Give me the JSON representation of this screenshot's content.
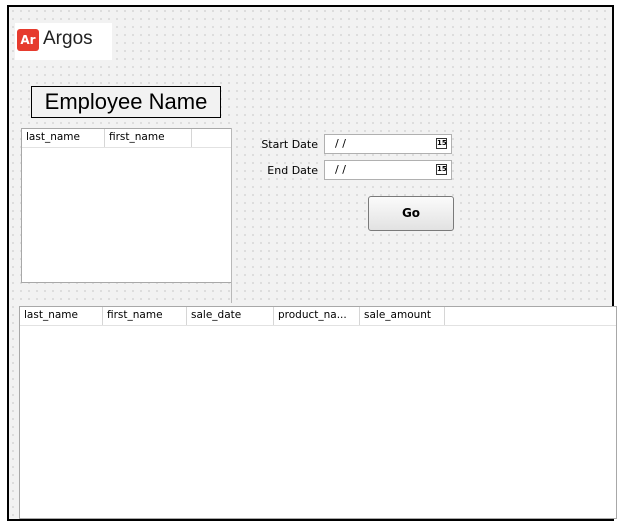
{
  "logo": {
    "badge": "Ar",
    "name": "Argos"
  },
  "employee_label": "Employee Name",
  "employee_grid": {
    "columns": [
      "last_name",
      "first_name"
    ]
  },
  "filters": {
    "start_date_label": "Start Date",
    "start_date_value": "/ /",
    "end_date_label": "End Date",
    "end_date_value": "/ /",
    "calendar_icon": "calendar-icon",
    "calendar_glyph": "15"
  },
  "go_button": "Go",
  "sales_grid": {
    "columns": [
      "last_name",
      "first_name",
      "sale_date",
      "product_na...",
      "sale_amount"
    ]
  }
}
